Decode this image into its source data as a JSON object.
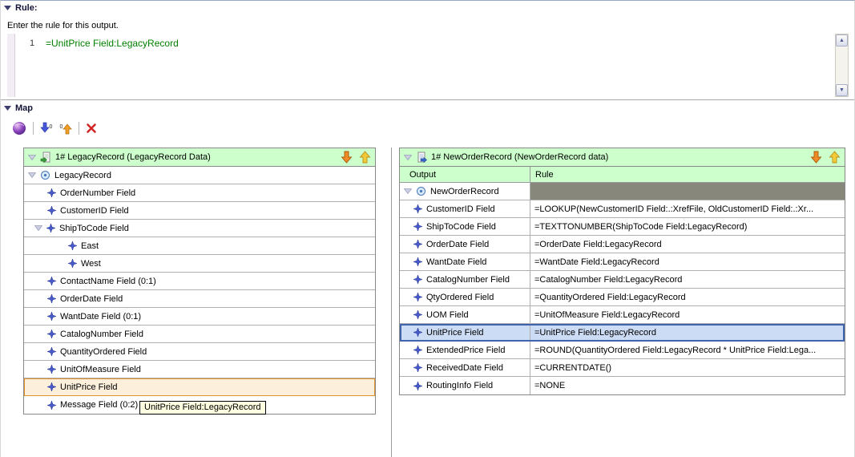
{
  "rule_section": {
    "title": "Rule:",
    "instruction": "Enter the rule for this output.",
    "line_number": "1",
    "code": "=UnitPrice Field:LegacyRecord"
  },
  "map_section": {
    "title": "Map"
  },
  "toolbar": {
    "icons": [
      {
        "name": "transformation-globe-icon"
      },
      {
        "name": "map-all-down-icon",
        "badge": "0"
      },
      {
        "name": "map-all-up-icon",
        "badge": "0"
      },
      {
        "name": "delete-x-icon"
      }
    ]
  },
  "left_panel": {
    "header": "1# LegacyRecord (LegacyRecord Data)",
    "items": [
      "LegacyRecord",
      "OrderNumber Field",
      "CustomerID Field",
      "ShipToCode Field",
      "East",
      "West",
      "ContactName Field (0:1)",
      "OrderDate Field",
      "WantDate Field (0:1)",
      "CatalogNumber Field",
      "QuantityOrdered Field",
      "UnitOfMeasure Field",
      "UnitPrice Field",
      "Message Field (0:2)"
    ]
  },
  "right_panel": {
    "header": "1# NewOrderRecord (NewOrderRecord data)",
    "columns": {
      "output": "Output",
      "rule": "Rule"
    },
    "rows": [
      {
        "output": "NewOrderRecord",
        "rule": ""
      },
      {
        "output": "CustomerID Field",
        "rule": "=LOOKUP(NewCustomerID Field:.:XrefFile, OldCustomerID Field:.:Xr..."
      },
      {
        "output": "ShipToCode Field",
        "rule": "=TEXTTONUMBER(ShipToCode Field:LegacyRecord)"
      },
      {
        "output": "OrderDate Field",
        "rule": "=OrderDate Field:LegacyRecord"
      },
      {
        "output": "WantDate Field",
        "rule": "=WantDate Field:LegacyRecord"
      },
      {
        "output": "CatalogNumber Field",
        "rule": "=CatalogNumber Field:LegacyRecord"
      },
      {
        "output": "QtyOrdered Field",
        "rule": "=QuantityOrdered Field:LegacyRecord"
      },
      {
        "output": "UOM Field",
        "rule": "=UnitOfMeasure Field:LegacyRecord"
      },
      {
        "output": "UnitPrice Field",
        "rule": "=UnitPrice Field:LegacyRecord"
      },
      {
        "output": "ExtendedPrice Field",
        "rule": "=ROUND(QuantityOrdered Field:LegacyRecord * UnitPrice Field:Lega..."
      },
      {
        "output": "ReceivedDate Field",
        "rule": "=CURRENTDATE()"
      },
      {
        "output": "RoutingInfo Field",
        "rule": "=NONE"
      }
    ]
  },
  "tooltip": {
    "text": "UnitPrice Field:LegacyRecord"
  },
  "colors": {
    "panel_header_green": "#ccffcc",
    "selected_row_blue": "#cddcf5",
    "selected_row_blue_border": "#3f63ad",
    "selected_row_orange_border": "#e0912c",
    "rule_code_green": "#008000",
    "unmapped_rule_cell": "#87877b"
  }
}
